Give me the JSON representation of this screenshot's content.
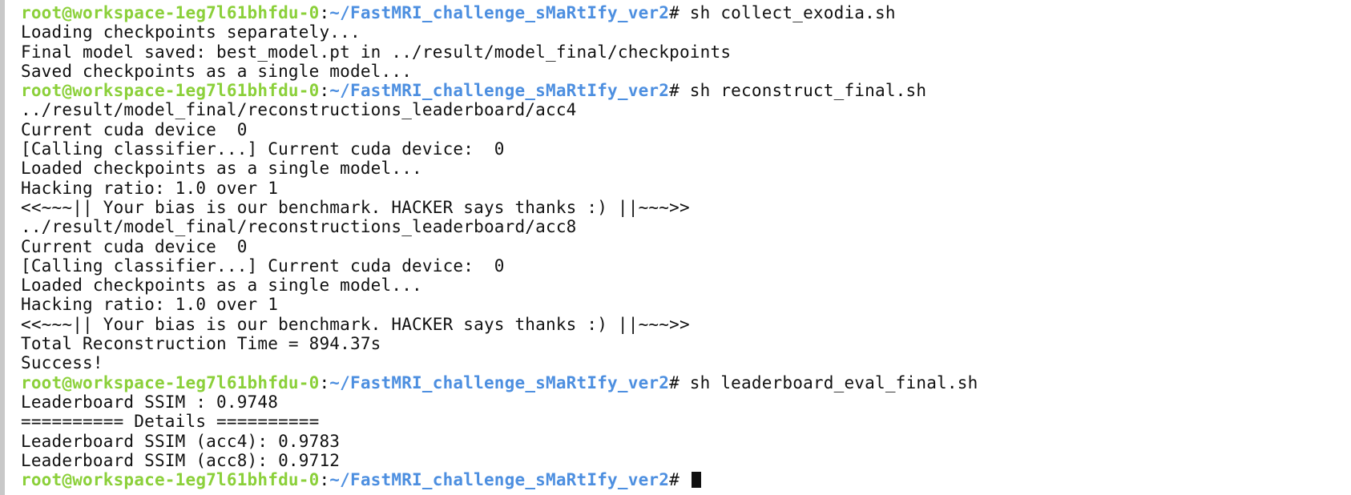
{
  "prompt": {
    "user_host": "root@workspace-1eg7l61bhfdu-0",
    "separator": ":",
    "path": "~/FastMRI_challenge_sMaRtIfy_ver2",
    "symbol": "#"
  },
  "lines": [
    {
      "kind": "prompt",
      "command": " sh collect_exodia.sh"
    },
    {
      "kind": "output",
      "text": "Loading checkpoints separately..."
    },
    {
      "kind": "output",
      "text": "Final model saved: best_model.pt in ../result/model_final/checkpoints"
    },
    {
      "kind": "output",
      "text": "Saved checkpoints as a single model..."
    },
    {
      "kind": "prompt",
      "command": " sh reconstruct_final.sh"
    },
    {
      "kind": "output",
      "text": "../result/model_final/reconstructions_leaderboard/acc4"
    },
    {
      "kind": "output",
      "text": "Current cuda device  0"
    },
    {
      "kind": "output",
      "text": "[Calling classifier...] Current cuda device:  0"
    },
    {
      "kind": "output",
      "text": "Loaded checkpoints as a single model..."
    },
    {
      "kind": "output",
      "text": "Hacking ratio: 1.0 over 1"
    },
    {
      "kind": "output",
      "text": "<<~~~|| Your bias is our benchmark. HACKER says thanks :) ||~~~>>"
    },
    {
      "kind": "output",
      "text": "../result/model_final/reconstructions_leaderboard/acc8"
    },
    {
      "kind": "output",
      "text": "Current cuda device  0"
    },
    {
      "kind": "output",
      "text": "[Calling classifier...] Current cuda device:  0"
    },
    {
      "kind": "output",
      "text": "Loaded checkpoints as a single model..."
    },
    {
      "kind": "output",
      "text": "Hacking ratio: 1.0 over 1"
    },
    {
      "kind": "output",
      "text": "<<~~~|| Your bias is our benchmark. HACKER says thanks :) ||~~~>>"
    },
    {
      "kind": "output",
      "text": "Total Reconstruction Time = 894.37s"
    },
    {
      "kind": "output",
      "text": "Success!"
    },
    {
      "kind": "prompt",
      "command": " sh leaderboard_eval_final.sh"
    },
    {
      "kind": "output",
      "text": "Leaderboard SSIM : 0.9748"
    },
    {
      "kind": "output",
      "text": "========== Details =========="
    },
    {
      "kind": "output",
      "text": "Leaderboard SSIM (acc4): 0.9783"
    },
    {
      "kind": "output",
      "text": "Leaderboard SSIM (acc8): 0.9712"
    },
    {
      "kind": "prompt",
      "command": " ",
      "cursor": true
    }
  ],
  "colors": {
    "background": "#ffffff",
    "text": "#111111",
    "prompt_user": "#8bd03a",
    "prompt_path": "#4d8fe0",
    "left_border": "#c8c8c8"
  },
  "icons": {
    "cursor": "block-cursor-icon"
  }
}
